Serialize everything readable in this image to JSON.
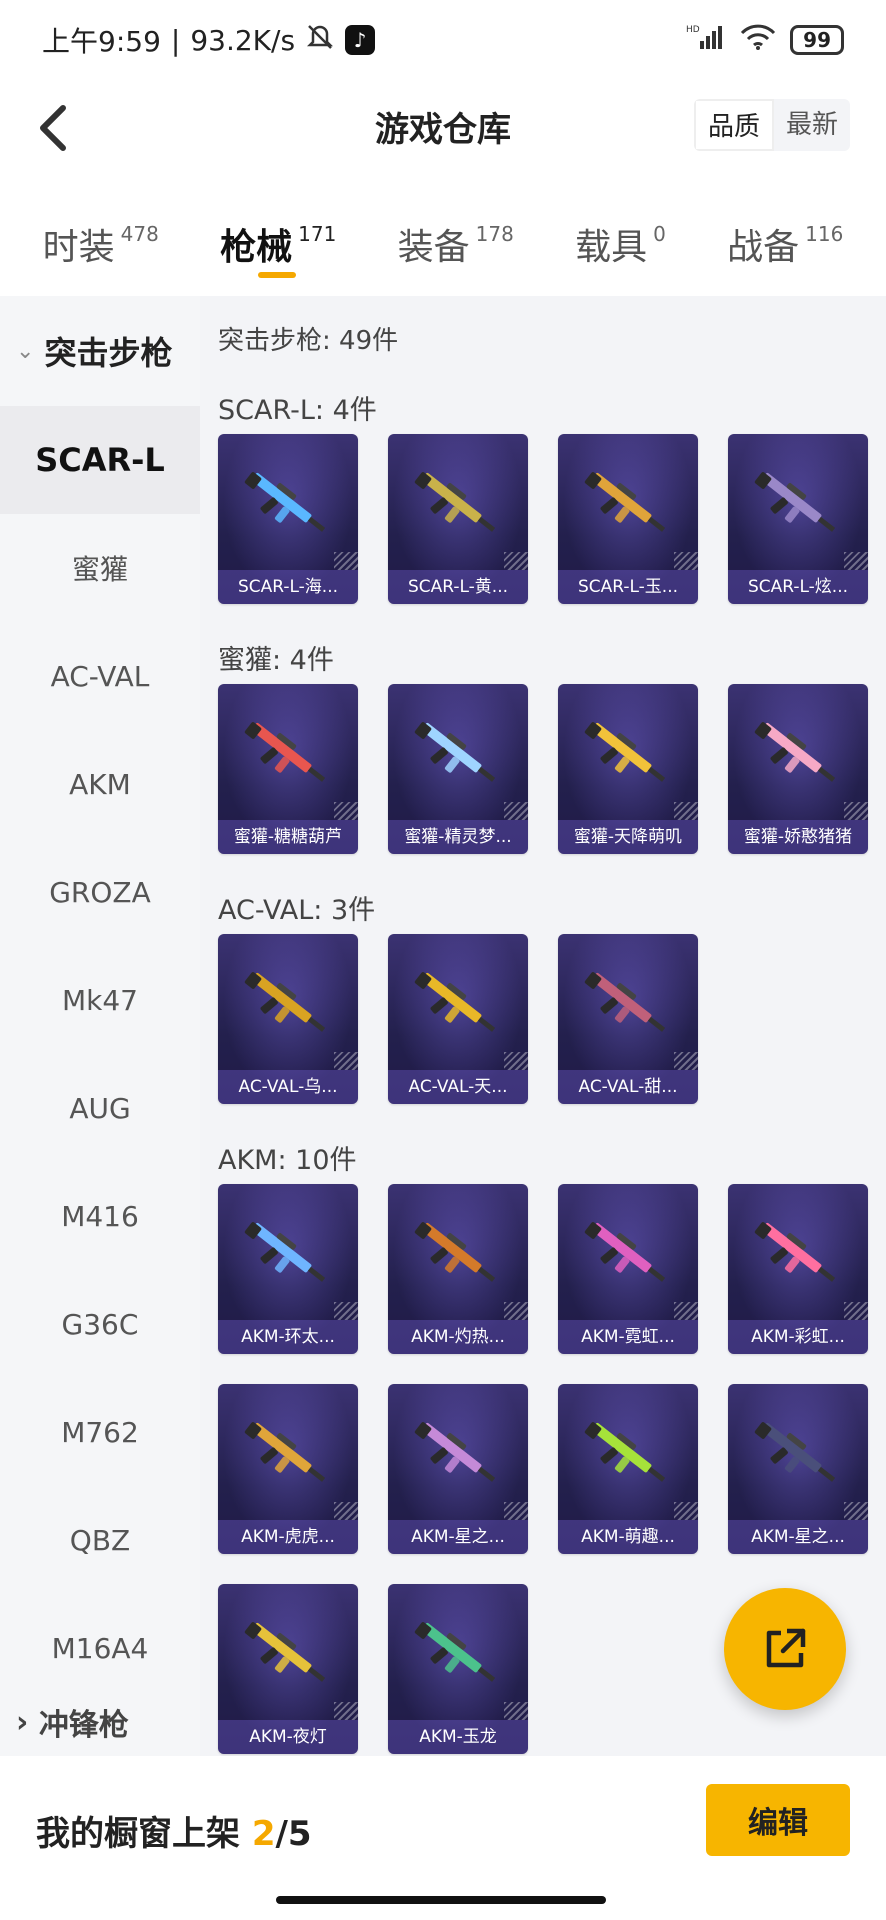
{
  "status_bar": {
    "time": "上午9:59",
    "net_speed": "93.2K/s",
    "signal_label": "HD",
    "battery": "99"
  },
  "header": {
    "title": "游戏仓库",
    "sort_options": [
      "品质",
      "最新"
    ]
  },
  "tabs": [
    {
      "label": "时装",
      "count": "478"
    },
    {
      "label": "枪械",
      "count": "171"
    },
    {
      "label": "装备",
      "count": "178"
    },
    {
      "label": "载具",
      "count": "0"
    },
    {
      "label": "战备",
      "count": "116"
    }
  ],
  "sidebar": {
    "section": "突击步枪",
    "items": [
      "SCAR-L",
      "蜜獾",
      "AC-VAL",
      "AKM",
      "GROZA",
      "Mk47",
      "AUG",
      "M416",
      "G36C",
      "M762",
      "QBZ",
      "M16A4"
    ],
    "next_section": "冲锋枪"
  },
  "content": {
    "total": "突击步枪: 49件",
    "groups": [
      {
        "title": "SCAR-L: 4件",
        "items": [
          {
            "label": "SCAR-L-海...",
            "color": "#5ab8ff"
          },
          {
            "label": "SCAR-L-黄...",
            "color": "#c9b24a"
          },
          {
            "label": "SCAR-L-玉...",
            "color": "#e0a43a"
          },
          {
            "label": "SCAR-L-炫...",
            "color": "#9a88c8"
          }
        ]
      },
      {
        "title": "蜜獾: 4件",
        "items": [
          {
            "label": "蜜獾-糖糖葫芦",
            "color": "#e8564f"
          },
          {
            "label": "蜜獾-精灵梦...",
            "color": "#9fd4ff"
          },
          {
            "label": "蜜獾-天降萌叽",
            "color": "#f1c23a"
          },
          {
            "label": "蜜獾-娇憨猪猪",
            "color": "#f6a9c6"
          }
        ]
      },
      {
        "title": "AC-VAL: 3件",
        "items": [
          {
            "label": "AC-VAL-乌...",
            "color": "#d9a322"
          },
          {
            "label": "AC-VAL-天...",
            "color": "#e8b828"
          },
          {
            "label": "AC-VAL-甜...",
            "color": "#c0607a"
          }
        ]
      },
      {
        "title": "AKM: 10件",
        "items": [
          {
            "label": "AKM-环太...",
            "color": "#6fb5ff"
          },
          {
            "label": "AKM-灼热...",
            "color": "#d47a2a"
          },
          {
            "label": "AKM-霓虹...",
            "color": "#e060c0"
          },
          {
            "label": "AKM-彩虹...",
            "color": "#ff6fa0"
          },
          {
            "label": "AKM-虎虎...",
            "color": "#e0a53a"
          },
          {
            "label": "AKM-星之...",
            "color": "#c58ad8"
          },
          {
            "label": "AKM-萌趣...",
            "color": "#a6e23a"
          },
          {
            "label": "AKM-星之...",
            "color": "#4a4f7a"
          },
          {
            "label": "AKM-夜灯",
            "color": "#e6c23a"
          },
          {
            "label": "AKM-玉龙",
            "color": "#4cc28c"
          }
        ]
      }
    ]
  },
  "bottom_bar": {
    "showcase_label": "我的橱窗上架",
    "showcase_current": "2",
    "showcase_total": "/5",
    "edit_label": "编辑"
  },
  "colors": {
    "accent": "#f7b500",
    "card_bg": "#2a2458"
  },
  "icons": [
    "back-arrow-icon",
    "mute-icon",
    "tiktok-icon",
    "signal-icon",
    "wifi-icon",
    "battery-icon",
    "chevron-down-icon",
    "share-export-icon"
  ]
}
